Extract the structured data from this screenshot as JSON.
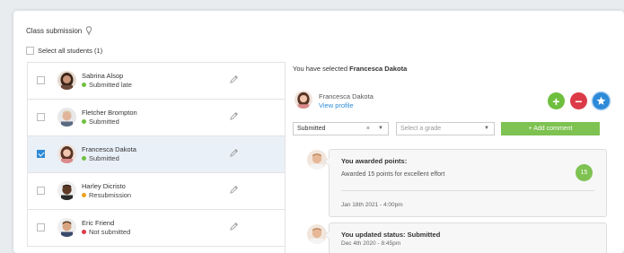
{
  "panel": {
    "title": "Class submission",
    "select_all_label": "Select all students (1)"
  },
  "students": [
    {
      "name": "Sabrina Alsop",
      "status": "Submitted late",
      "status_color": "#6fbf3f",
      "checked": false,
      "selected": false
    },
    {
      "name": "Fletcher Brompton",
      "status": "Submitted",
      "status_color": "#6fbf3f",
      "checked": false,
      "selected": false
    },
    {
      "name": "Francesca Dakota",
      "status": "Submitted",
      "status_color": "#6fbf3f",
      "checked": true,
      "selected": true
    },
    {
      "name": "Harley Dicristo",
      "status": "Resubmission",
      "status_color": "#f0a020",
      "checked": false,
      "selected": false
    },
    {
      "name": "Eric Friend",
      "status": "Not submitted",
      "status_color": "#dd3a47",
      "checked": false,
      "selected": false
    }
  ],
  "detail": {
    "selected_prefix": "You have selected ",
    "selected_name": "Francesca Dakota",
    "profile_name": "Francesca Dakota",
    "view_profile": "View profile",
    "status_select": {
      "value": "Submitted",
      "clear": "×",
      "arrow": "▼"
    },
    "grade_select": {
      "placeholder": "Select a grade",
      "arrow": "▼"
    },
    "add_comment": "+ Add comment",
    "action_icons": [
      "plus-icon",
      "minus-icon",
      "star-icon"
    ]
  },
  "feed": [
    {
      "title": "You awarded points:",
      "description": "Awarded 15 points for excellent effort",
      "points": "15",
      "date": "Jan 18th 2021 - 4:00pm"
    },
    {
      "title": "You updated status: Submitted",
      "date": "Dec 4th 2020 - 8:45pm"
    }
  ],
  "colors": {
    "accent_blue": "#2d8ad8",
    "green": "#7ec251",
    "red": "#dd3a47",
    "orange": "#f0a020"
  }
}
